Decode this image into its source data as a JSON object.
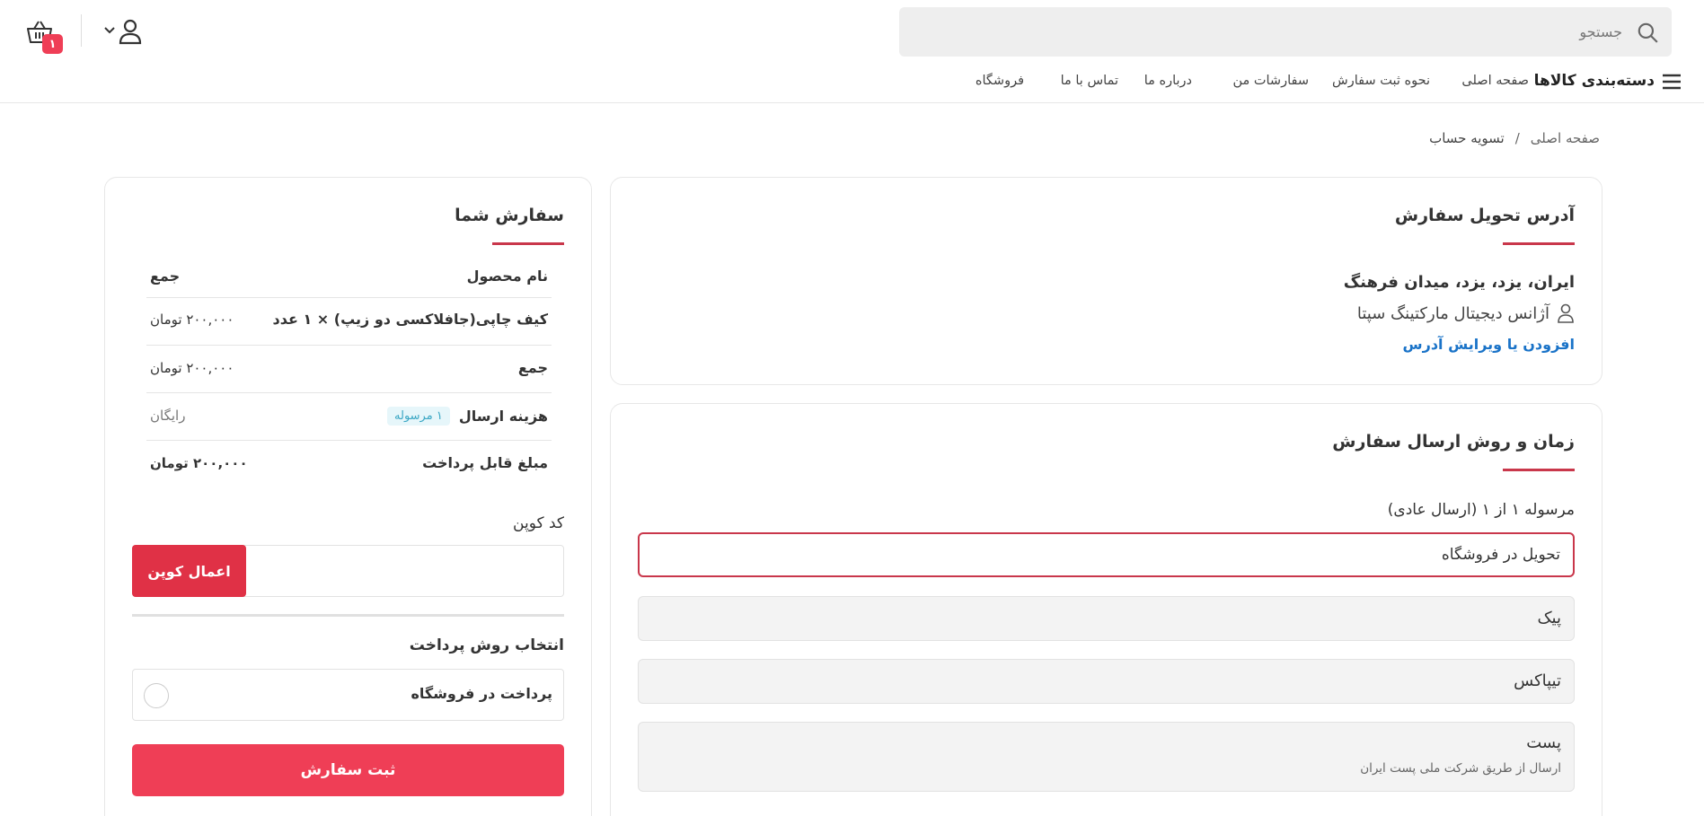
{
  "header": {
    "search_placeholder": "جستجو",
    "cart_count": "۱"
  },
  "nav": {
    "categories_label": "دسته‌بندی کالاها",
    "links": [
      "صفحه اصلی",
      "نحوه ثبت سفارش",
      "سفارشات من",
      "درباره ما",
      "تماس با ما",
      "فروشگاه"
    ]
  },
  "breadcrumb": {
    "home": "صفحه اصلی",
    "separator": "/",
    "current": "تسویه حساب"
  },
  "address": {
    "title": "آدرس تحویل سفارش",
    "line": "ایران، یزد، یزد، میدان فرهنگ",
    "name": "آژانس دیجیتال مارکتینگ سپتا",
    "edit_link": "افزودن یا ویرایش آدرس"
  },
  "shipping": {
    "title": "زمان و روش ارسال سفارش",
    "parcel_label": "مرسوله ۱ از ۱ (ارسال عادی)",
    "options": [
      {
        "label": "تحویل در فروشگاه",
        "selected": true
      },
      {
        "label": "پیک"
      },
      {
        "label": "تیپاکس"
      },
      {
        "label": "پست",
        "sub": "ارسال از طریق شرکت ملی پست ایران"
      }
    ]
  },
  "order": {
    "title": "سفارش شما",
    "col_product": "نام محصول",
    "col_total": "جمع",
    "item_name": "کیف چاپی(جافلاکسی دو زیپ) × ۱ عدد",
    "item_price": "۲۰۰,۰۰۰ تومان",
    "subtotal_label": "جمع",
    "subtotal_value": "۲۰۰,۰۰۰ تومان",
    "shipping_label": "هزینه ارسال",
    "shipping_badge": "۱ مرسوله",
    "shipping_value": "رایگان",
    "total_label": "مبلغ قابل پرداخت",
    "total_value": "۲۰۰,۰۰۰ تومان",
    "coupon_label": "کد کوپن",
    "coupon_button": "اعمال کوپن",
    "payment_label": "انتخاب روش پرداخت",
    "payment_option": "پرداخت در فروشگاه",
    "submit_button": "ثبت سفارش"
  },
  "colors": {
    "accent": "#ef3e56",
    "underline": "#c9374b",
    "link": "#1a73c8"
  }
}
